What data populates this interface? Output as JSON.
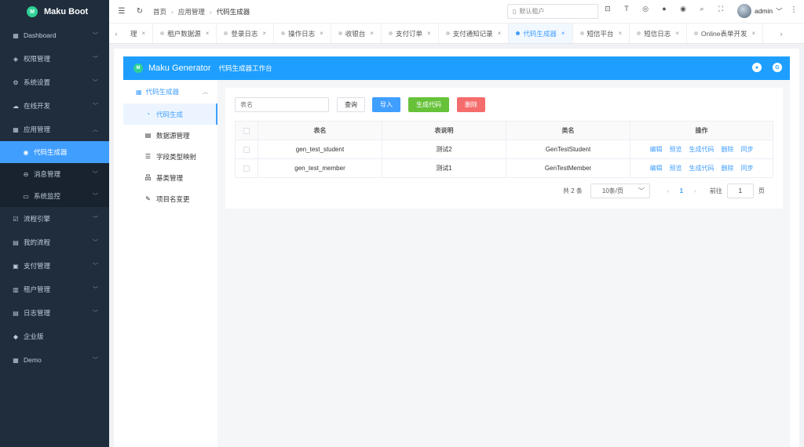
{
  "app": {
    "title": "Maku Boot",
    "logo_text": "M"
  },
  "sidebar": {
    "items": [
      {
        "label": "Dashboard",
        "icon": "grid-icon"
      },
      {
        "label": "权限管理",
        "icon": "shield-icon"
      },
      {
        "label": "系统设置",
        "icon": "gear-icon"
      },
      {
        "label": "在线开发",
        "icon": "cloud-icon"
      },
      {
        "label": "应用管理",
        "icon": "apps-icon"
      },
      {
        "label": "代码生成器",
        "icon": "flame-icon"
      },
      {
        "label": "消息管理",
        "icon": "message-icon"
      },
      {
        "label": "系统监控",
        "icon": "monitor-icon"
      },
      {
        "label": "流程引擎",
        "icon": "flow-icon"
      },
      {
        "label": "我的流程",
        "icon": "document-icon"
      },
      {
        "label": "支付管理",
        "icon": "pay-icon"
      },
      {
        "label": "租户管理",
        "icon": "tenant-icon"
      },
      {
        "label": "日志管理",
        "icon": "log-icon"
      },
      {
        "label": "企业版",
        "icon": "diamond-icon"
      },
      {
        "label": "Demo",
        "icon": "demo-icon"
      }
    ]
  },
  "header": {
    "breadcrumb": [
      "首页",
      "应用管理",
      "代码生成器"
    ],
    "tenant_placeholder": "默认租户",
    "user_name": "admin"
  },
  "tabs": [
    {
      "label": "理"
    },
    {
      "label": "租户数据源"
    },
    {
      "label": "登录日志"
    },
    {
      "label": "操作日志"
    },
    {
      "label": "收银台"
    },
    {
      "label": "支付订单"
    },
    {
      "label": "支付通知记录"
    },
    {
      "label": "代码生成器",
      "active": true
    },
    {
      "label": "短信平台"
    },
    {
      "label": "短信日志"
    },
    {
      "label": "Online表单开发"
    }
  ],
  "generator": {
    "title": "Maku Generator",
    "subtitle": "代码生成器工作台",
    "nav_group": "代码生成器",
    "nav_items": [
      {
        "label": "代码生成",
        "icon": "flame-icon",
        "active": true
      },
      {
        "label": "数据源管理",
        "icon": "database-icon"
      },
      {
        "label": "字段类型映射",
        "icon": "list-icon"
      },
      {
        "label": "基类管理",
        "icon": "hierarchy-icon"
      },
      {
        "label": "项目名变更",
        "icon": "edit-icon"
      }
    ],
    "search_placeholder": "表名",
    "buttons": {
      "query": "查询",
      "import": "导入",
      "generate": "生成代码",
      "delete": "删除"
    },
    "table": {
      "headers": [
        "表名",
        "表说明",
        "类名",
        "操作"
      ],
      "rows": [
        {
          "table_name": "gen_test_student",
          "comment": "测试2",
          "class_name": "GenTestStudent"
        },
        {
          "table_name": "gen_test_member",
          "comment": "测试1",
          "class_name": "GenTestMember"
        }
      ],
      "actions": [
        "编辑",
        "预览",
        "生成代码",
        "删除",
        "同步"
      ]
    },
    "pagination": {
      "total_text": "共 2 条",
      "page_size": "10条/页",
      "current_page": "1",
      "goto_label": "前往",
      "goto_value": "1",
      "page_unit": "页"
    }
  },
  "colors": {
    "primary": "#409eff",
    "sidebar_bg": "#1f2d3d",
    "success": "#67c23a",
    "danger": "#f56c6c",
    "banner": "#1e9fff"
  }
}
